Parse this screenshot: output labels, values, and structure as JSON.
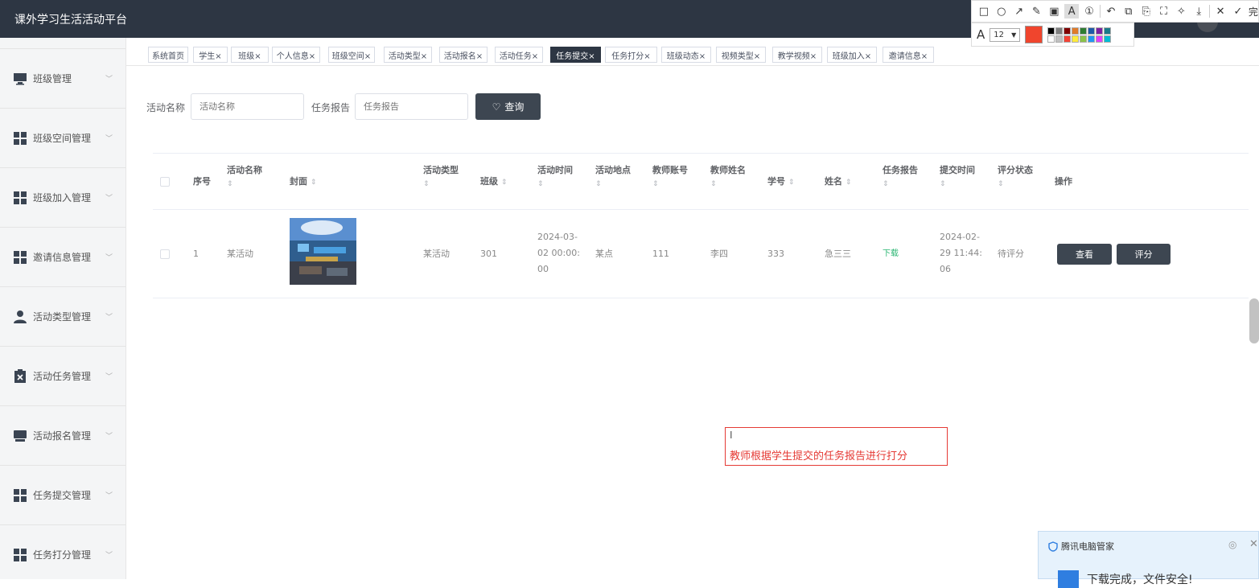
{
  "header": {
    "brand": "课外学习生活活动平台"
  },
  "snap_toolbar": {
    "tools": [
      "□",
      "○",
      "↗",
      "✎",
      "▣",
      "A",
      "①",
      "↶",
      "⧉",
      "⎘",
      "⛶",
      "✧",
      "⤓",
      "✕",
      "✓"
    ],
    "done_label": "完",
    "font_size": "12",
    "current_color": "#f0452d",
    "swatches": [
      "#000000",
      "#808080",
      "#800000",
      "#e07b2a",
      "#2e7d32",
      "#1e5aa8",
      "#7b1fa2",
      "#1a7a8a",
      "#ffffff",
      "#c0c0c0",
      "#f44336",
      "#ffeb3b",
      "#8bc34a",
      "#2196f3",
      "#e040fb",
      "#00bcd4"
    ]
  },
  "sidebar": {
    "items": [
      {
        "label": "班级管理",
        "icon": "monitor-icon"
      },
      {
        "label": "班级空间管理",
        "icon": "grid-icon"
      },
      {
        "label": "班级加入管理",
        "icon": "grid-icon"
      },
      {
        "label": "邀请信息管理",
        "icon": "grid-icon"
      },
      {
        "label": "活动类型管理",
        "icon": "user-icon"
      },
      {
        "label": "活动任务管理",
        "icon": "clipboard-icon"
      },
      {
        "label": "活动报名管理",
        "icon": "store-icon"
      },
      {
        "label": "任务提交管理",
        "icon": "grid-icon"
      },
      {
        "label": "任务打分管理",
        "icon": "grid-icon"
      }
    ]
  },
  "tabs": [
    "系统首页",
    "学生×",
    "班级×",
    "个人信息×",
    "班级空间×",
    "活动类型×",
    "活动报名×",
    "活动任务×",
    "任务提交×",
    "任务打分×",
    "班级动态×",
    "视频类型×",
    "教学视频×",
    "班级加入×",
    "邀请信息×"
  ],
  "active_tab": "任务提交×",
  "search": {
    "activity_label": "活动名称",
    "activity_placeholder": "活动名称",
    "report_label": "任务报告",
    "report_placeholder": "任务报告",
    "query_label": "查询"
  },
  "table": {
    "headers": {
      "index": "序号",
      "activity_name": "活动名称",
      "cover": "封面",
      "activity_type": "活动类型",
      "class": "班级",
      "activity_time": "活动时间",
      "location": "活动地点",
      "teacher_account": "教师账号",
      "teacher_name": "教师姓名",
      "student_no": "学号",
      "name": "姓名",
      "report": "任务报告",
      "submit_time": "提交时间",
      "score_status": "评分状态",
      "actions": "操作"
    },
    "sort_glyph": "⇕",
    "rows": [
      {
        "index": "1",
        "activity_name": "某活动",
        "activity_type": "某活动",
        "class": "301",
        "activity_time_l1": "2024-03-",
        "activity_time_l2": "02 00:00:",
        "activity_time_l3": "00",
        "location": "某点",
        "teacher_account": "111",
        "teacher_name": "李四",
        "student_no": "333",
        "name": "急三三",
        "report": "下载",
        "submit_time_l1": "2024-02-",
        "submit_time_l2": "29 11:44:",
        "submit_time_l3": "06",
        "score_status": "待评分",
        "view_label": "查看",
        "score_label": "评分"
      }
    ]
  },
  "annotation": {
    "caret": "I",
    "text": "教师根据学生提交的任务报告进行打分",
    "color": "#e53a35"
  },
  "notification": {
    "title": "腾讯电脑管家",
    "body": "下载完成，文件安全!"
  }
}
